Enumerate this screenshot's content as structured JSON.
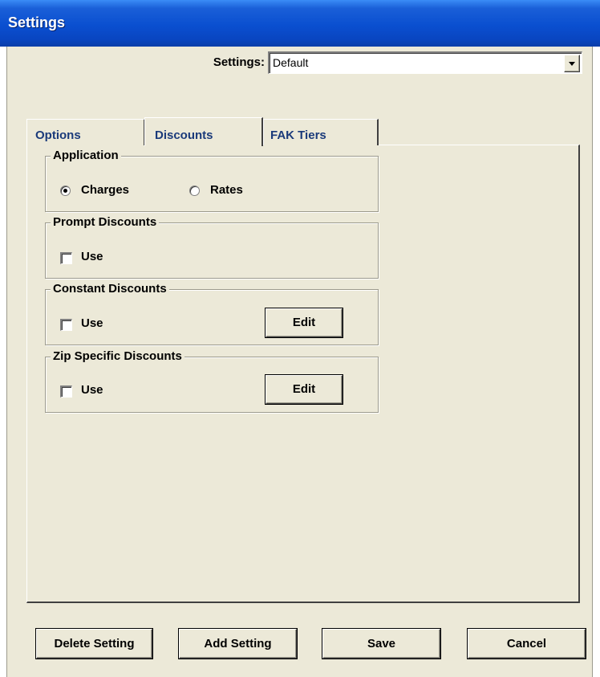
{
  "window": {
    "title": "Settings"
  },
  "settings_selector": {
    "label": "Settings:",
    "value": "Default"
  },
  "tabs": [
    {
      "label": "Options",
      "active": false
    },
    {
      "label": "Discounts",
      "active": true
    },
    {
      "label": "FAK Tiers",
      "active": false
    }
  ],
  "groups": {
    "application": {
      "title": "Application",
      "options": [
        {
          "label": "Charges",
          "checked": true
        },
        {
          "label": "Rates",
          "checked": false
        }
      ]
    },
    "prompt_discounts": {
      "title": "Prompt Discounts",
      "use_label": "Use",
      "use_checked": false
    },
    "constant_discounts": {
      "title": "Constant Discounts",
      "use_label": "Use",
      "use_checked": false,
      "edit_label": "Edit"
    },
    "zip_specific_discounts": {
      "title": "Zip Specific Discounts",
      "use_label": "Use",
      "use_checked": false,
      "edit_label": "Edit"
    }
  },
  "footer": {
    "delete_label": "Delete Setting",
    "add_label": "Add Setting",
    "save_label": "Save",
    "cancel_label": "Cancel"
  }
}
